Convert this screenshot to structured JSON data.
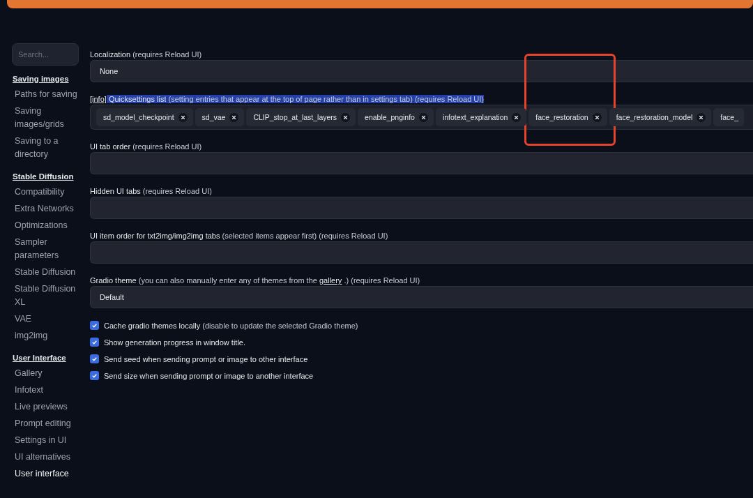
{
  "top_button": {
    "kind": "apply"
  },
  "sidebar": {
    "search": {
      "placeholder": "Search..."
    },
    "groups": [
      {
        "heading": "Saving images",
        "items": [
          {
            "label": "Paths for saving",
            "selected": false
          },
          {
            "label": "Saving images/grids",
            "selected": false
          },
          {
            "label": "Saving to a directory",
            "selected": false
          }
        ]
      },
      {
        "heading": "Stable Diffusion",
        "items": [
          {
            "label": "Compatibility",
            "selected": false
          },
          {
            "label": "Extra Networks",
            "selected": false
          },
          {
            "label": "Optimizations",
            "selected": false
          },
          {
            "label": "Sampler parameters",
            "selected": false
          },
          {
            "label": "Stable Diffusion",
            "selected": false
          },
          {
            "label": "Stable Diffusion XL",
            "selected": false
          },
          {
            "label": "VAE",
            "selected": false
          },
          {
            "label": "img2img",
            "selected": false
          }
        ]
      },
      {
        "heading": "User Interface",
        "items": [
          {
            "label": "Gallery",
            "selected": false
          },
          {
            "label": "Infotext",
            "selected": false
          },
          {
            "label": "Live previews",
            "selected": false
          },
          {
            "label": "Prompt editing",
            "selected": false
          },
          {
            "label": "Settings in UI",
            "selected": false
          },
          {
            "label": "UI alternatives",
            "selected": false
          },
          {
            "label": "User interface",
            "selected": true
          }
        ]
      }
    ]
  },
  "settings": [
    {
      "kind": "dropdown",
      "label": [
        {
          "text": "Localization ",
          "kind": "name"
        },
        {
          "text": "(requires Reload UI)",
          "kind": "note"
        }
      ],
      "value": "None"
    },
    {
      "kind": "chips",
      "label": [
        {
          "text": "[info]",
          "kind": "link"
        },
        {
          "text": "Quicksettings list",
          "kind": "name",
          "highlighted": true
        },
        {
          "text": "(setting entries that appear at the top of page rather than in settings tab) (requires Reload UI)",
          "kind": "note",
          "highlighted": true
        }
      ],
      "chips": [
        {
          "text": "sd_model_checkpoint",
          "highlighted": false
        },
        {
          "text": "sd_vae",
          "highlighted": false
        },
        {
          "text": "CLIP_stop_at_last_layers",
          "highlighted": false
        },
        {
          "text": "enable_pnginfo",
          "highlighted": false
        },
        {
          "text": "infotext_explanation",
          "highlighted": false
        },
        {
          "text": "face_restoration",
          "highlighted": true
        },
        {
          "text": "face_restoration_model",
          "highlighted": false
        },
        {
          "text": "face_",
          "highlighted": false
        }
      ]
    },
    {
      "kind": "dropdown",
      "label": [
        {
          "text": "UI tab order ",
          "kind": "name"
        },
        {
          "text": "(requires Reload UI)",
          "kind": "note"
        }
      ]
    },
    {
      "kind": "dropdown",
      "label": [
        {
          "text": "Hidden UI tabs ",
          "kind": "name"
        },
        {
          "text": "(requires Reload UI)",
          "kind": "note"
        }
      ]
    },
    {
      "kind": "dropdown",
      "label": [
        {
          "text": "UI item order for txt2img/img2img tabs",
          "kind": "name"
        },
        {
          "text": "(selected items appear first) (requires Reload UI)",
          "kind": "note"
        }
      ]
    },
    {
      "kind": "dropdown",
      "label": [
        {
          "text": "Gradio theme",
          "kind": "name"
        },
        {
          "text": "(you can also manually enter any of themes from the",
          "kind": "note"
        },
        {
          "text": "gallery",
          "kind": "link"
        },
        {
          "text": ".) (requires Reload UI)",
          "kind": "note"
        }
      ],
      "value": "Default"
    },
    {
      "kind": "checkbox",
      "checked": true,
      "label": [
        {
          "text": "Cache gradio themes locally",
          "kind": "name"
        },
        {
          "text": "(disable to update the selected Gradio theme)",
          "kind": "note"
        }
      ]
    },
    {
      "kind": "checkbox",
      "checked": true,
      "label": [
        {
          "text": "Show generation progress in window title.",
          "kind": "name"
        }
      ]
    },
    {
      "kind": "checkbox",
      "checked": true,
      "label": [
        {
          "text": "Send seed when sending prompt or image to other interface",
          "kind": "name"
        }
      ]
    },
    {
      "kind": "checkbox",
      "checked": true,
      "label": [
        {
          "text": "Send size when sending prompt or image to another interface",
          "kind": "name"
        }
      ]
    }
  ]
}
